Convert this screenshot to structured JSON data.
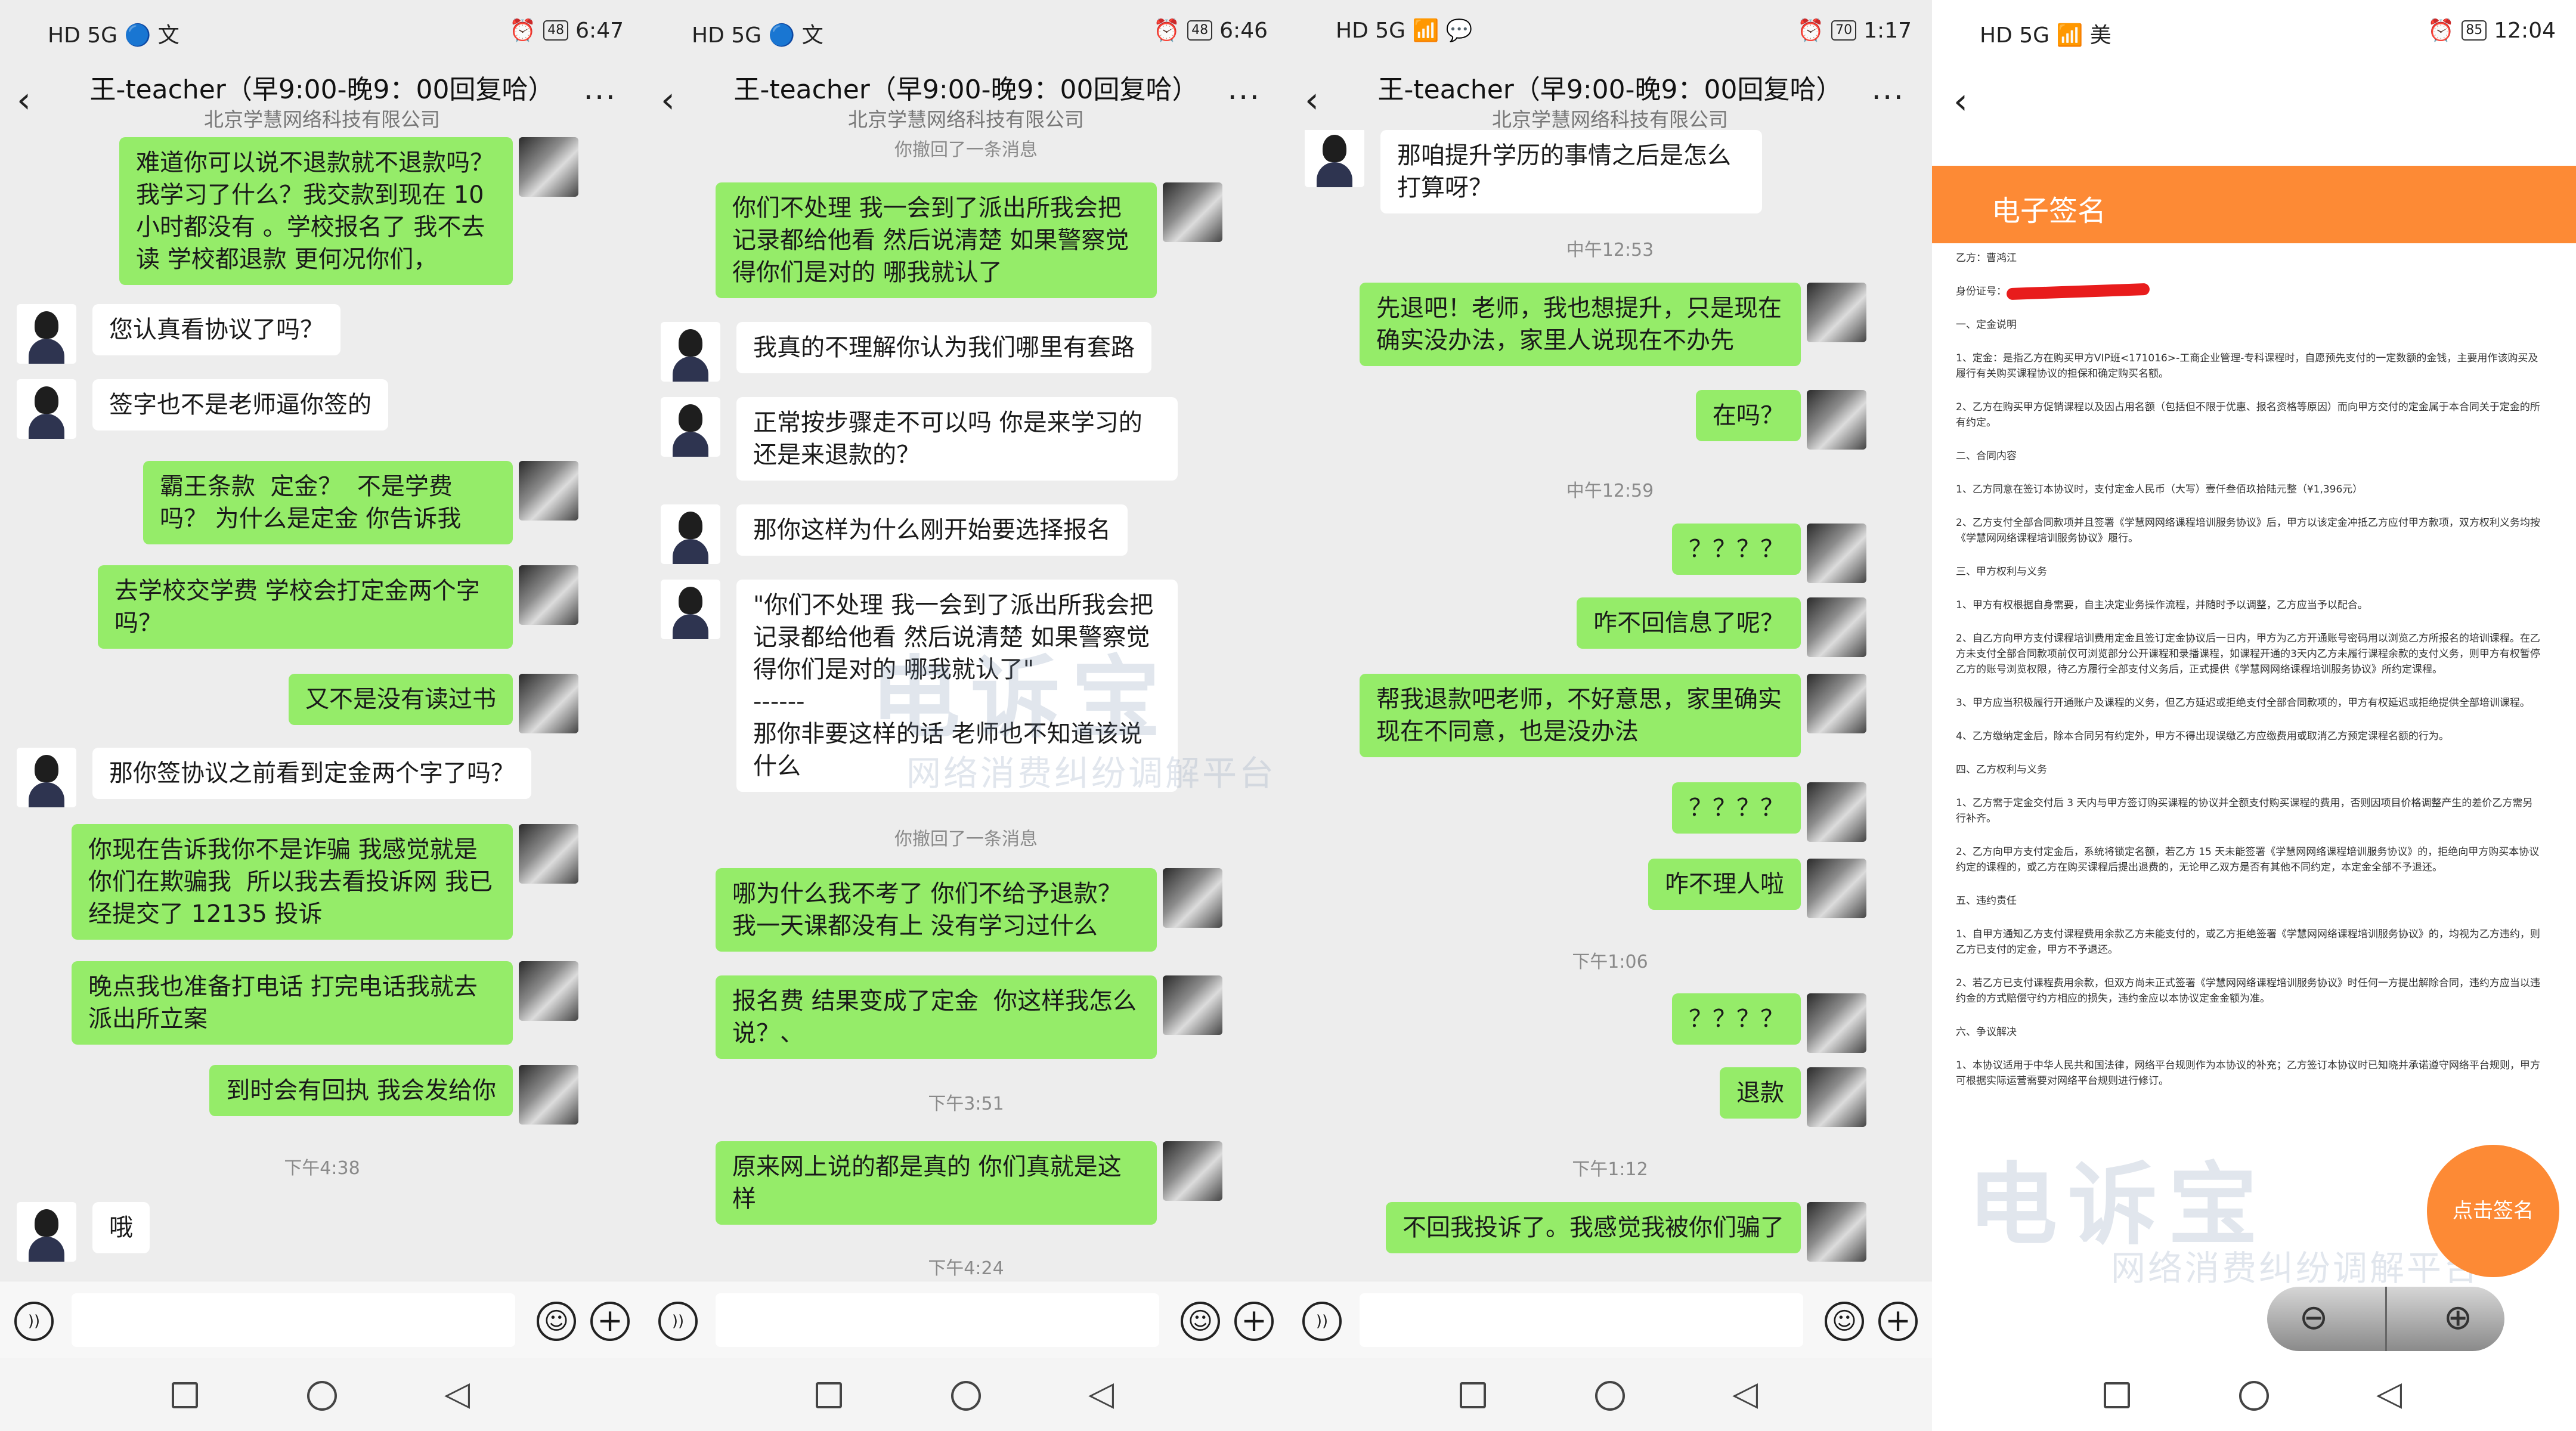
{
  "screens": [
    {
      "status": {
        "left": "HD 5G 🔵 文",
        "battery": "48",
        "time": "6:47"
      },
      "header": {
        "title": "王-teacher（早9:00-晚9：00回复哈）",
        "subtitle": "北京学慧网络科技有限公司"
      },
      "messages": [
        {
          "text": "难道你可以说不退款就不退款吗？我学习了什么？我交款到现在 10 小时都没有 。学校报名了 我不去读 学校都退款 更何况你们，"
        },
        {
          "text": "您认真看协议了吗？"
        },
        {
          "text": "签字也不是老师逼你签的"
        },
        {
          "text": "霸王条款  定金？  不是学费吗？ 为什么是定金 你告诉我"
        },
        {
          "text": "去学校交学费 学校会打定金两个字吗？"
        },
        {
          "text": "又不是没有读过书"
        },
        {
          "text": "那你签协议之前看到定金两个字了吗？"
        },
        {
          "text": "你现在告诉我你不是诈骗 我感觉就是你们在欺骗我  所以我去看投诉网 我已经提交了 12135 投诉"
        },
        {
          "text": "晚点我也准备打电话 打完电话我就去派出所立案"
        },
        {
          "text": "到时会有回执 我会发给你"
        },
        {
          "text": "下午4:38"
        },
        {
          "text": "哦"
        }
      ]
    },
    {
      "status": {
        "left": "HD 5G 🔵 文",
        "battery": "48",
        "time": "6:46"
      },
      "header": {
        "title": "王-teacher（早9:00-晚9：00回复哈）",
        "subtitle": "北京学慧网络科技有限公司"
      },
      "messages": [
        {
          "text": "你撤回了一条消息"
        },
        {
          "text": "你们不处理 我一会到了派出所我会把记录都给他看 然后说清楚 如果警察觉得你们是对的 哪我就认了"
        },
        {
          "text": "我真的不理解你认为我们哪里有套路"
        },
        {
          "text": "正常按步骤走不可以吗 你是来学习的还是来退款的？"
        },
        {
          "text": "那你这样为什么刚开始要选择报名"
        },
        {
          "text": "\"你们不处理 我一会到了派出所我会把记录都给他看 然后说清楚 如果警察觉得你们是对的 哪我就认了\"\n------\n那你非要这样的话 老师也不知道该说什么"
        },
        {
          "text": "你撤回了一条消息"
        },
        {
          "text": "哪为什么我不考了 你们不给予退款？我一天课都没有上 没有学习过什么"
        },
        {
          "text": "报名费 结果变成了定金  你这样我怎么说？、"
        },
        {
          "text": "下午3:51"
        },
        {
          "text": "原来网上说的都是真的 你们真就是这样"
        },
        {
          "text": "下午4:24"
        }
      ]
    },
    {
      "status": {
        "left": "HD 5G 📶 💬",
        "battery": "70",
        "time": "1:17"
      },
      "header": {
        "title": "王-teacher（早9:00-晚9：00回复哈）",
        "subtitle": "北京学慧网络科技有限公司"
      },
      "messages": [
        {
          "text": "那咱提升学历的事情之后是怎么打算呀？"
        },
        {
          "text": "中午12:53"
        },
        {
          "text": "先退吧！老师，我也想提升，只是现在确实没办法，家里人说现在不办先"
        },
        {
          "text": "在吗？"
        },
        {
          "text": "中午12:59"
        },
        {
          "text": "？？？？"
        },
        {
          "text": "咋不回信息了呢？"
        },
        {
          "text": "帮我退款吧老师，不好意思，家里确实现在不同意，也是没办法"
        },
        {
          "text": "？？？？"
        },
        {
          "text": "咋不理人啦"
        },
        {
          "text": "下午1:06"
        },
        {
          "text": "？？？？"
        },
        {
          "text": "退款"
        },
        {
          "text": "下午1:12"
        },
        {
          "text": "不回我投诉了。我感觉我被你们骗了"
        }
      ]
    },
    {
      "status": {
        "left": "HD 5G 📶 美",
        "battery": "85",
        "time": "12:04"
      },
      "header": {
        "title": "电子签名"
      },
      "doc": [
        "乙方：曹鸿江",
        "身份证号：",
        "一、定金说明",
        "1、定金：是指乙方在购买甲方VIP班<171016>-工商企业管理-专科课程时，自愿预先支付的一定数额的金钱，主要用作该购买及履行有关购买课程协议的担保和确定购买名额。",
        "2、乙方在购买甲方促销课程以及因占用名额（包括但不限于优惠、报名资格等原因）而向甲方交付的定金属于本合同关于定金的所有约定。",
        "二、合同内容",
        "1、乙方同意在签订本协议时，支付定金人民币（大写）壹仟叁佰玖拾陆元整（¥1,396元）",
        "2、乙方支付全部合同款项并且签署《学慧网网络课程培训服务协议》后，甲方以该定金冲抵乙方应付甲方款项，双方权利义务均按《学慧网网络课程培训服务协议》履行。",
        "三、甲方权利与义务",
        "1、甲方有权根据自身需要，自主决定业务操作流程，并随时予以调整，乙方应当予以配合。",
        "2、自乙方向甲方支付课程培训费用定金且签订定金协议后一日内，甲方为乙方开通账号密码用以浏览乙方所报名的培训课程。在乙方未支付全部合同款项前仅可浏览部分公开课程和录播课程，如课程开通的3天内乙方未履行课程余款的支付义务，则甲方有权暂停乙方的账号浏览权限，待乙方履行全部支付义务后，正式提供《学慧网网络课程培训服务协议》所约定课程。",
        "3、甲方应当积极履行开通账户及课程的义务，但乙方延迟或拒绝支付全部合同款项的，甲方有权延迟或拒绝提供全部培训课程。",
        "4、乙方缴纳定金后，除本合同另有约定外，甲方不得出现误缴乙方应缴费用或取消乙方预定课程名额的行为。",
        "四、乙方权利与义务",
        "1、乙方需于定金交付后 3 天内与甲方签订购买课程的协议并全额支付购买课程的费用，否则因项目价格调整产生的差价乙方需另行补齐。",
        "2、乙方向甲方支付定金后，系统将锁定名额，若乙方 15 天未能签署《学慧网网络课程培训服务协议》的，拒绝向甲方购买本协议约定的课程的，或乙方在购买课程后提出退费的，无论甲乙双方是否有其他不同约定，本定金全部不予退还。",
        "五、违约责任",
        "1、自甲方通知乙方支付课程费用余款乙方未能支付的，或乙方拒绝签署《学慧网网络课程培训服务协议》的，均视为乙方违约，则乙方已支付的定金，甲方不予退还。",
        "2、若乙方已支付课程费用余款，但双方尚未正式签署《学慧网网络课程培训服务协议》时任何一方提出解除合同，违约方应当以违约金的方式赔偿守约方相应的损失，违约金应以本协议定金金额为准。",
        "六、争议解决",
        "1、本协议适用于中华人民共和国法律，网络平台规则作为本协议的补充；乙方签订本协议时已知晓并承诺遵守网络平台规则，甲方可根据实际运营需要对网络平台规则进行修订。"
      ],
      "floating_button": "点击签名"
    }
  ],
  "watermark": {
    "main": "电诉宝",
    "sub": "网络消费纠纷调解平台"
  }
}
